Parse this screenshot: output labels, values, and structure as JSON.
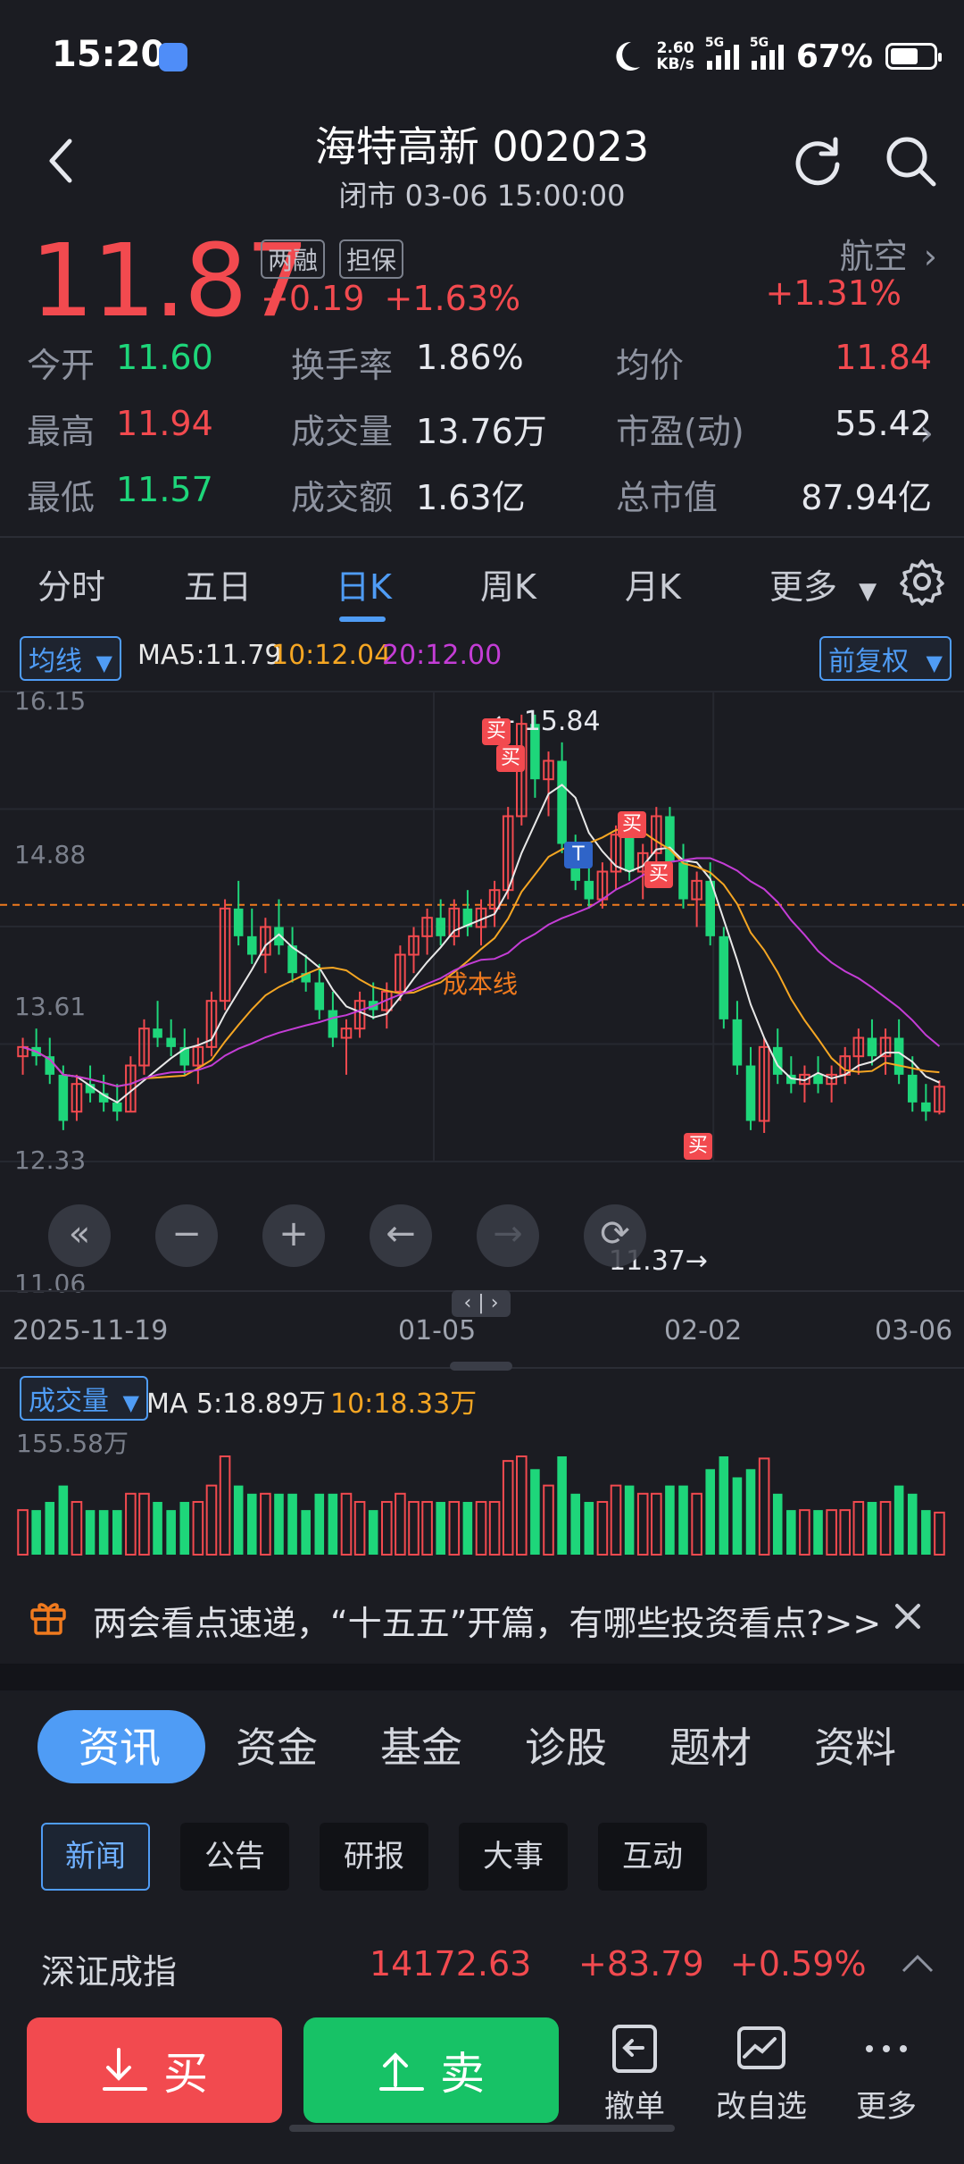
{
  "status_bar": {
    "time": "15:20",
    "net_speed_value": "2.60",
    "net_speed_unit": "KB/s",
    "sim1": "5G",
    "sim2": "5G",
    "battery": "67%"
  },
  "header": {
    "title": "海特高新 002023",
    "subtitle": "闭市 03-06 15:00:00"
  },
  "quote": {
    "price": "11.87",
    "tag_margin": "两融",
    "tag_collateral": "担保",
    "change": "+0.19",
    "change_pct": "+1.63%",
    "sector": "航空",
    "sector_pct": "+1.31%"
  },
  "stats": {
    "open_label": "今开",
    "open": "11.60",
    "turnover_label": "换手率",
    "turnover": "1.86%",
    "avg_label": "均价",
    "avg": "11.84",
    "high_label": "最高",
    "high": "11.94",
    "volume_label": "成交量",
    "volume": "13.76万",
    "pe_label": "市盈(动)",
    "pe": "55.42",
    "low_label": "最低",
    "low": "11.57",
    "amount_label": "成交额",
    "amount": "1.63亿",
    "mktcap_label": "总市值",
    "mktcap": "87.94亿"
  },
  "chart_tabs": [
    "分时",
    "五日",
    "日K",
    "周K",
    "月K",
    "更多"
  ],
  "kline": {
    "ma_chip": "均线",
    "ma5": "MA5:11.79",
    "ma10": "10:12.04",
    "ma20": "20:12.00",
    "adjust": "前复权",
    "y_ticks": [
      "16.15",
      "14.88",
      "13.61",
      "12.33",
      "11.06"
    ],
    "x_ticks": [
      "2025-11-19",
      "01-05",
      "02-02",
      "03-06"
    ],
    "cost_line_label": "成本线",
    "max_label": "15.84",
    "min_label": "11.37",
    "buy_marker": "买",
    "t_marker": "T",
    "colors": {
      "up": "#f24a4f",
      "down": "#1ed67a",
      "ma5": "#e8e8e8",
      "ma10": "#f5a623",
      "ma20": "#c43dd6",
      "cost": "#f07a1e"
    }
  },
  "volume": {
    "chip": "成交量",
    "ma5": "MA 5:18.89万",
    "ma10": "10:18.33万",
    "max_tick": "155.58万"
  },
  "news_banner": {
    "text": "两会看点速递，“十五五”开篇，有哪些投资看点?>>"
  },
  "info_tabs": [
    "资讯",
    "资金",
    "基金",
    "诊股",
    "题材",
    "资料"
  ],
  "info_subtabs": [
    "新闻",
    "公告",
    "研报",
    "大事",
    "互动"
  ],
  "index_row": {
    "name": "深证成指",
    "value": "14172.63",
    "change": "+83.79",
    "change_pct": "+0.59%"
  },
  "bottom_bar": {
    "buy": "买",
    "sell": "卖",
    "cancel": "撤单",
    "edit_watchlist": "改自选",
    "more": "更多"
  },
  "chart_data": {
    "type": "candlestick",
    "title": "",
    "ylim": [
      11.06,
      16.15
    ],
    "x_start": "2025-11-19",
    "x_end": "03-06",
    "ohlc_approx": [
      [
        12.2,
        12.4,
        12.0,
        12.3
      ],
      [
        12.3,
        12.5,
        12.1,
        12.2
      ],
      [
        12.2,
        12.4,
        11.9,
        12.0
      ],
      [
        12.0,
        12.1,
        11.4,
        11.5
      ],
      [
        11.6,
        12.0,
        11.5,
        11.9
      ],
      [
        11.9,
        12.1,
        11.7,
        11.8
      ],
      [
        11.8,
        12.0,
        11.6,
        11.7
      ],
      [
        11.7,
        11.9,
        11.5,
        11.6
      ],
      [
        11.6,
        12.2,
        11.6,
        12.1
      ],
      [
        12.1,
        12.6,
        12.0,
        12.5
      ],
      [
        12.5,
        12.8,
        12.3,
        12.4
      ],
      [
        12.4,
        12.6,
        12.2,
        12.3
      ],
      [
        12.3,
        12.5,
        12.0,
        12.1
      ],
      [
        12.1,
        12.4,
        11.9,
        12.3
      ],
      [
        12.3,
        12.9,
        12.2,
        12.8
      ],
      [
        12.8,
        13.9,
        12.7,
        13.8
      ],
      [
        13.8,
        14.1,
        13.4,
        13.5
      ],
      [
        13.5,
        13.8,
        13.2,
        13.3
      ],
      [
        13.3,
        13.7,
        13.1,
        13.6
      ],
      [
        13.6,
        13.9,
        13.3,
        13.4
      ],
      [
        13.4,
        13.6,
        13.0,
        13.1
      ],
      [
        13.1,
        13.3,
        12.9,
        13.0
      ],
      [
        13.0,
        13.2,
        12.6,
        12.7
      ],
      [
        12.7,
        12.9,
        12.3,
        12.4
      ],
      [
        12.4,
        12.6,
        12.0,
        12.5
      ],
      [
        12.5,
        12.9,
        12.4,
        12.8
      ],
      [
        12.8,
        13.0,
        12.6,
        12.7
      ],
      [
        12.7,
        13.0,
        12.5,
        12.9
      ],
      [
        12.9,
        13.4,
        12.8,
        13.3
      ],
      [
        13.3,
        13.6,
        13.1,
        13.5
      ],
      [
        13.5,
        13.8,
        13.3,
        13.7
      ],
      [
        13.7,
        13.9,
        13.4,
        13.5
      ],
      [
        13.5,
        13.9,
        13.4,
        13.8
      ],
      [
        13.8,
        14.0,
        13.5,
        13.6
      ],
      [
        13.6,
        13.9,
        13.4,
        13.8
      ],
      [
        13.8,
        14.1,
        13.6,
        14.0
      ],
      [
        14.0,
        14.9,
        13.9,
        14.8
      ],
      [
        14.8,
        15.9,
        14.7,
        15.8
      ],
      [
        15.8,
        15.9,
        15.0,
        15.2
      ],
      [
        15.2,
        15.5,
        14.8,
        15.4
      ],
      [
        15.4,
        15.6,
        14.4,
        14.5
      ],
      [
        14.5,
        14.6,
        14.0,
        14.1
      ],
      [
        14.1,
        14.3,
        13.8,
        13.9
      ],
      [
        13.9,
        14.3,
        13.8,
        14.2
      ],
      [
        14.2,
        14.7,
        14.0,
        14.6
      ],
      [
        14.6,
        14.8,
        14.1,
        14.2
      ],
      [
        14.2,
        14.5,
        13.9,
        14.4
      ],
      [
        14.4,
        14.9,
        14.3,
        14.8
      ],
      [
        14.8,
        14.9,
        14.2,
        14.3
      ],
      [
        14.3,
        14.5,
        13.8,
        13.9
      ],
      [
        13.9,
        14.2,
        13.6,
        14.1
      ],
      [
        14.1,
        14.3,
        13.4,
        13.5
      ],
      [
        13.5,
        13.6,
        12.5,
        12.6
      ],
      [
        12.6,
        12.8,
        12.0,
        12.1
      ],
      [
        12.1,
        12.3,
        11.4,
        11.5
      ],
      [
        11.5,
        12.4,
        11.37,
        12.3
      ],
      [
        12.3,
        12.5,
        11.9,
        12.0
      ],
      [
        12.0,
        12.2,
        11.8,
        11.9
      ],
      [
        11.9,
        12.1,
        11.7,
        12.0
      ],
      [
        12.0,
        12.2,
        11.8,
        11.9
      ],
      [
        11.9,
        12.1,
        11.7,
        12.0
      ],
      [
        12.0,
        12.3,
        11.9,
        12.2
      ],
      [
        12.2,
        12.5,
        12.0,
        12.4
      ],
      [
        12.4,
        12.6,
        12.1,
        12.2
      ],
      [
        12.2,
        12.5,
        12.0,
        12.4
      ],
      [
        12.4,
        12.6,
        11.9,
        12.0
      ],
      [
        12.0,
        12.2,
        11.6,
        11.7
      ],
      [
        11.7,
        11.9,
        11.5,
        11.6
      ],
      [
        11.6,
        11.94,
        11.57,
        11.87
      ]
    ]
  }
}
